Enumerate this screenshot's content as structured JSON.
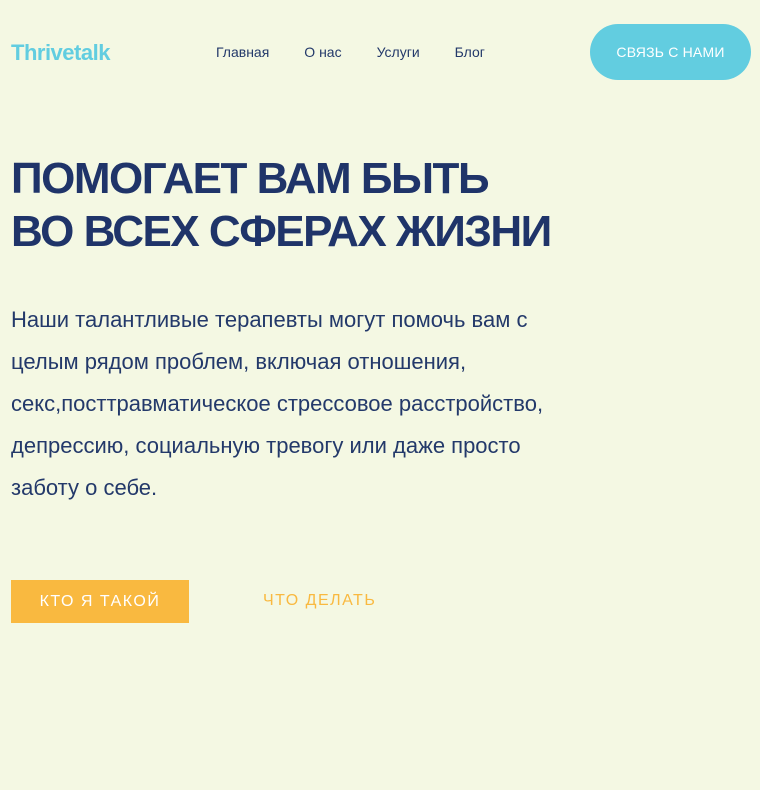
{
  "header": {
    "logo": "Thrivetalk",
    "nav": [
      {
        "label": "Главная"
      },
      {
        "label": "О нас"
      },
      {
        "label": "Услуги"
      },
      {
        "label": "Блог"
      }
    ],
    "contact_label": "СВЯЗЬ С НАМИ"
  },
  "hero": {
    "title_line1": "ПОМОГАЕТ ВАМ БЫТЬ",
    "title_line2": "ВО ВСЕХ СФЕРАХ ЖИЗНИ",
    "text": "Наши талантливые терапевты могут помочь вам с целым рядом проблем, включая отношения, секс,посттравматическое стрессовое расстройство, депрессию, социальную тревогу или даже просто заботу о себе.",
    "primary_button": "КТО Я ТАКОЙ",
    "secondary_button": "ЧТО ДЕЛАТЬ"
  },
  "colors": {
    "background": "#f4f8e3",
    "accent_blue": "#62cde0",
    "accent_yellow": "#f9b940",
    "text_dark": "#1f3469"
  }
}
